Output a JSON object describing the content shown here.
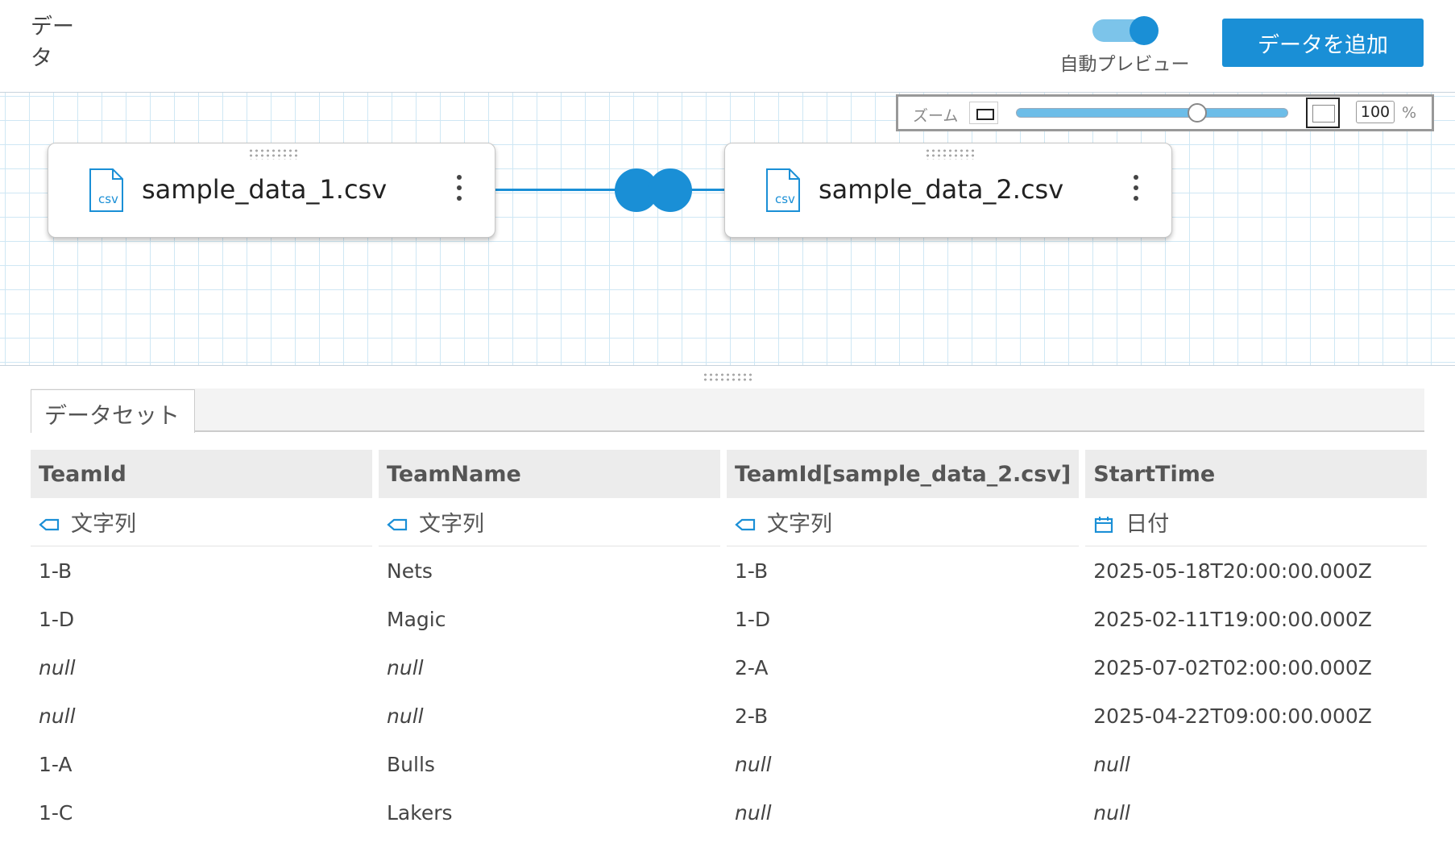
{
  "header": {
    "title": "データ",
    "auto_preview_label": "自動プレビュー",
    "auto_preview_on": true,
    "add_data_label": "データを追加"
  },
  "zoom": {
    "label": "ズーム",
    "value": "100",
    "unit": "%"
  },
  "nodes": [
    {
      "icon_text": "csv",
      "name": "sample_data_1.csv"
    },
    {
      "icon_text": "csv",
      "name": "sample_data_2.csv"
    }
  ],
  "tabs": [
    {
      "label": "データセット",
      "active": true
    }
  ],
  "table": {
    "columns": [
      {
        "name": "TeamId",
        "type": "文字列",
        "type_icon": "tag-icon"
      },
      {
        "name": "TeamName",
        "type": "文字列",
        "type_icon": "tag-icon"
      },
      {
        "name": "TeamId[sample_data_2.csv]",
        "type": "文字列",
        "type_icon": "tag-icon"
      },
      {
        "name": "StartTime",
        "type": "日付",
        "type_icon": "calendar-icon"
      }
    ],
    "rows": [
      [
        "1-B",
        "Nets",
        "1-B",
        "2025-05-18T20:00:00.000Z"
      ],
      [
        "1-D",
        "Magic",
        "1-D",
        "2025-02-11T19:00:00.000Z"
      ],
      [
        "null",
        "null",
        "2-A",
        "2025-07-02T02:00:00.000Z"
      ],
      [
        "null",
        "null",
        "2-B",
        "2025-04-22T09:00:00.000Z"
      ],
      [
        "1-A",
        "Bulls",
        "null",
        "null"
      ],
      [
        "1-C",
        "Lakers",
        "null",
        "null"
      ]
    ]
  },
  "colors": {
    "accent": "#1a8fd6",
    "grid_line": "#cfe7f4",
    "header_bg": "#ececec"
  }
}
